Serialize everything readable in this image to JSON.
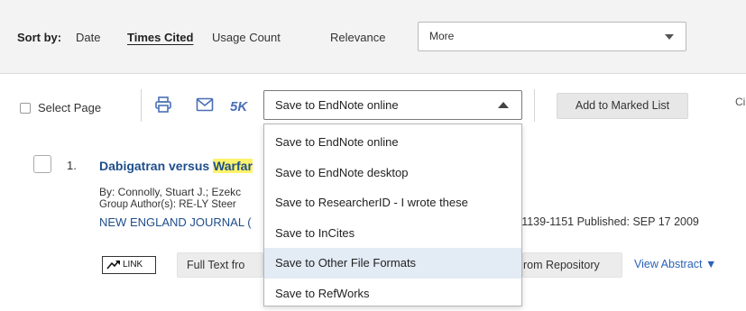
{
  "sort": {
    "label": "Sort by:",
    "options": [
      "Date",
      "Times Cited",
      "Usage Count",
      "Relevance"
    ],
    "active_option": "Times Cited",
    "more_select_value": "More"
  },
  "toolbar": {
    "select_page_label": "Select Page",
    "five_k_label": "5K",
    "save_select_value": "Save to EndNote online",
    "add_marked_list_label": "Add to Marked List",
    "cut_off_text": "Ci"
  },
  "save_dropdown": {
    "items": [
      "Save to EndNote online",
      "Save to EndNote desktop",
      "Save to ResearcherID - I wrote these",
      "Save to InCites",
      "Save to Other File Formats",
      "Save to RefWorks"
    ],
    "hovered_item": "Save to Other File Formats"
  },
  "record": {
    "number": "1.",
    "title_prefix": "Dabigatran versus ",
    "title_highlight": "Warfar",
    "by_line": "By: Connolly, Stuart J.; Ezekc",
    "group_author_line": "Group Author(s): RE-LY Steer",
    "journal": "NEW ENGLAND JOURNAL (",
    "pages_published": "s: 1139-1151   Published: SEP 17 2009",
    "link_label": "LINK",
    "full_text_label": "Full Text fro",
    "repository_label": "rom Repository",
    "view_abstract_label": "View Abstract ▼"
  },
  "colors": {
    "link_blue": "#1f4e8c",
    "highlight": "#fff36b",
    "hover_row": "#e3ebf5",
    "sort_bar_bg": "#f3f3f3"
  },
  "icons": [
    "printer-icon",
    "envelope-icon",
    "chevron-up-icon",
    "chevron-down-icon",
    "link-arrow-icon"
  ]
}
